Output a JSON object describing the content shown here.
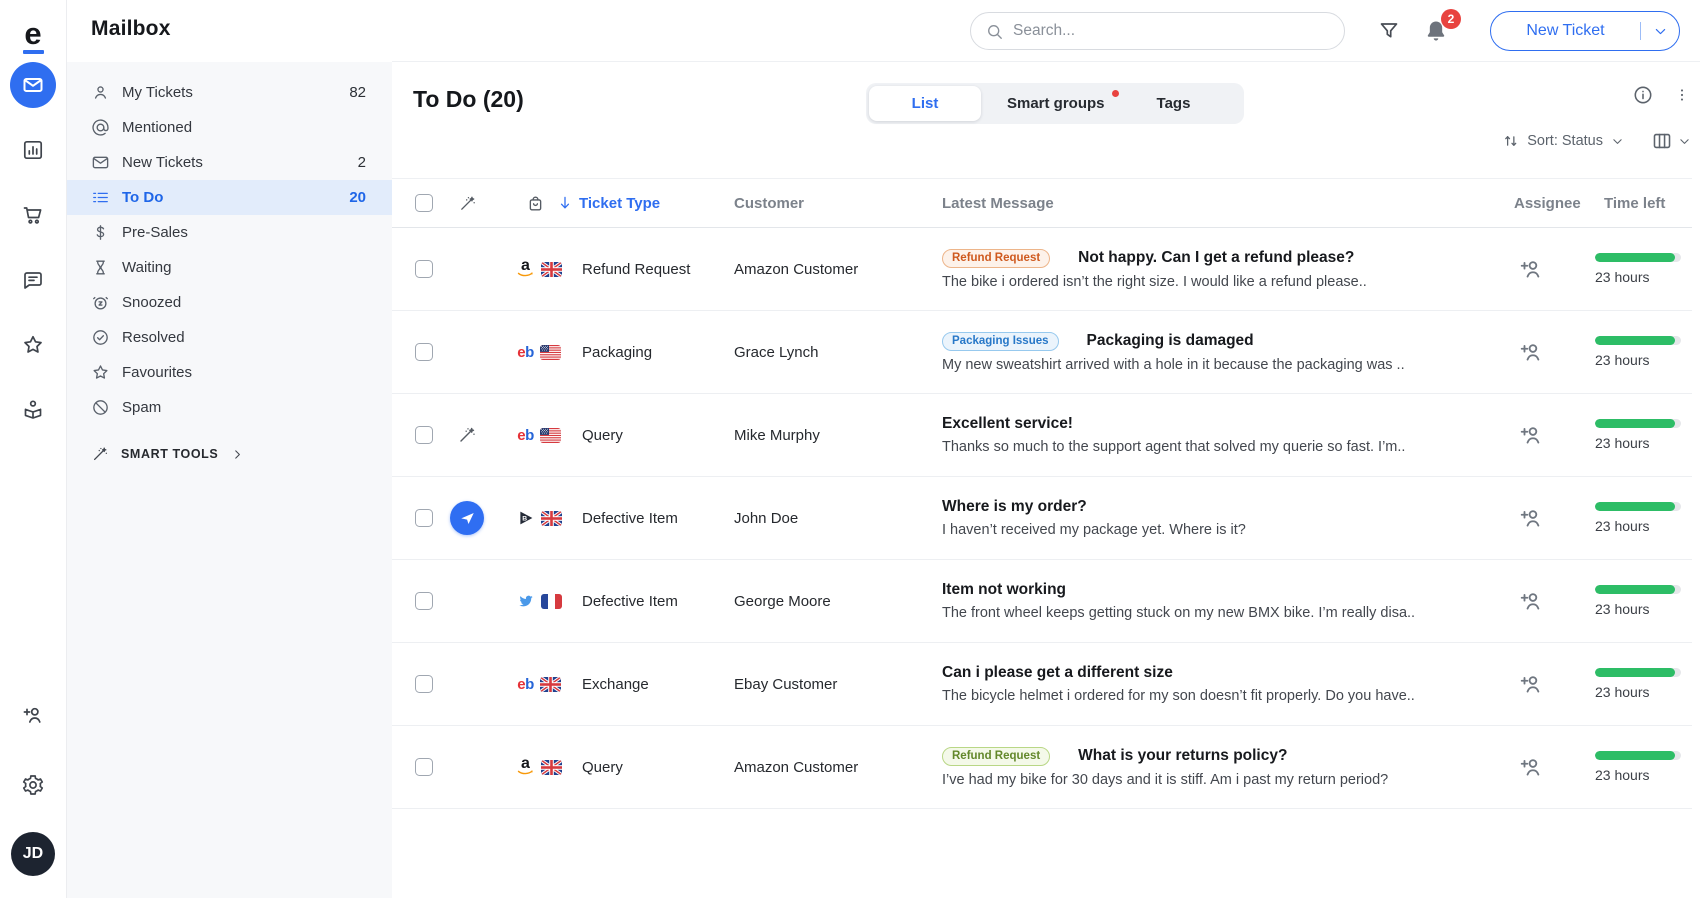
{
  "app": {
    "logo_letter": "e",
    "title": "Mailbox"
  },
  "rail": {
    "items": [
      {
        "icon": "mail",
        "active": true
      },
      {
        "icon": "analytics",
        "active": false
      },
      {
        "icon": "cart",
        "active": false
      },
      {
        "icon": "chat",
        "active": false
      },
      {
        "icon": "star",
        "active": false
      },
      {
        "icon": "handover",
        "active": false
      }
    ],
    "bottom": [
      {
        "icon": "add-user"
      },
      {
        "icon": "gear"
      }
    ],
    "avatar_initials": "JD"
  },
  "topbar": {
    "search_placeholder": "Search...",
    "notification_count": "2",
    "new_ticket_label": "New Ticket"
  },
  "sidebar": {
    "items": [
      {
        "icon": "person",
        "label": "My Tickets",
        "count": "82",
        "active": false
      },
      {
        "icon": "at",
        "label": "Mentioned",
        "count": "",
        "active": false
      },
      {
        "icon": "envelope",
        "label": "New Tickets",
        "count": "2",
        "active": false
      },
      {
        "icon": "todo-list",
        "label": "To Do",
        "count": "20",
        "active": true
      },
      {
        "icon": "dollar",
        "label": "Pre-Sales",
        "count": "",
        "active": false
      },
      {
        "icon": "hourglass",
        "label": "Waiting",
        "count": "",
        "active": false
      },
      {
        "icon": "snooze",
        "label": "Snoozed",
        "count": "",
        "active": false
      },
      {
        "icon": "check-circle",
        "label": "Resolved",
        "count": "",
        "active": false
      },
      {
        "icon": "star",
        "label": "Favourites",
        "count": "",
        "active": false
      },
      {
        "icon": "block",
        "label": "Spam",
        "count": "",
        "active": false
      }
    ],
    "smart_tools_label": "SMART TOOLS"
  },
  "content": {
    "title": "To Do (20)",
    "tabs": [
      {
        "label": "List",
        "active": true,
        "dot": false
      },
      {
        "label": "Smart groups",
        "active": false,
        "dot": true
      },
      {
        "label": "Tags",
        "active": false,
        "dot": false
      }
    ],
    "sort_label": "Sort: Status",
    "table": {
      "headers": {
        "ticket_type": "Ticket Type",
        "customer": "Customer",
        "latest_message": "Latest Message",
        "assignee": "Assignee",
        "time_left": "Time left"
      },
      "rows": [
        {
          "channel": "amazon",
          "flag": "uk",
          "type": "Refund Request",
          "customer": "Amazon Customer",
          "tag": {
            "label": "Refund Request",
            "color": "orange"
          },
          "title": "Not happy. Can I get a refund please?",
          "preview": "The bike i ordered isn’t the right size. I would like a refund please..",
          "time_left": "23 hours",
          "progress": 93,
          "wand": false,
          "send": false
        },
        {
          "channel": "ebay",
          "flag": "us",
          "type": "Packaging",
          "customer": "Grace Lynch",
          "tag": {
            "label": "Packaging Issues",
            "color": "blue"
          },
          "title": "Packaging is damaged",
          "preview": "My new sweatshirt arrived with a hole in it because the packaging was ..",
          "time_left": "23 hours",
          "progress": 93,
          "wand": false,
          "send": false
        },
        {
          "channel": "ebay",
          "flag": "us",
          "type": "Query",
          "customer": "Mike Murphy",
          "tag": null,
          "title": "Excellent service!",
          "preview": "Thanks so much to the support agent that solved my querie so fast. I’m..",
          "time_left": "23 hours",
          "progress": 93,
          "wand": true,
          "send": false
        },
        {
          "channel": "bmark",
          "flag": "uk",
          "type": "Defective Item",
          "customer": "John Doe",
          "tag": null,
          "title": "Where is my order?",
          "preview": "I haven’t received my package yet. Where is it?",
          "time_left": "23 hours",
          "progress": 93,
          "wand": false,
          "send": true
        },
        {
          "channel": "twitter",
          "flag": "fr",
          "type": "Defective Item",
          "customer": "George Moore",
          "tag": null,
          "title": "Item not working",
          "preview": "The front wheel keeps getting stuck on my new BMX bike. I’m really disa..",
          "time_left": "23 hours",
          "progress": 93,
          "wand": false,
          "send": false
        },
        {
          "channel": "ebay",
          "flag": "uk",
          "type": "Exchange",
          "customer": "Ebay Customer",
          "tag": null,
          "title": "Can i please get a different size",
          "preview": "The bicycle helmet i ordered for my son doesn’t fit properly. Do you have..",
          "time_left": "23 hours",
          "progress": 93,
          "wand": false,
          "send": false
        },
        {
          "channel": "amazon",
          "flag": "uk",
          "type": "Query",
          "customer": "Amazon Customer",
          "tag": {
            "label": "Refund Request",
            "color": "green"
          },
          "title": "What is your returns policy?",
          "preview": "I’ve had my bike for 30 days and it is stiff. Am i past my return period?",
          "time_left": "23 hours",
          "progress": 93,
          "wand": false,
          "send": false
        }
      ]
    }
  },
  "colors": {
    "accent": "#2f6ef0",
    "progress_green": "#2dbd66",
    "badge_red": "#e8433f"
  }
}
